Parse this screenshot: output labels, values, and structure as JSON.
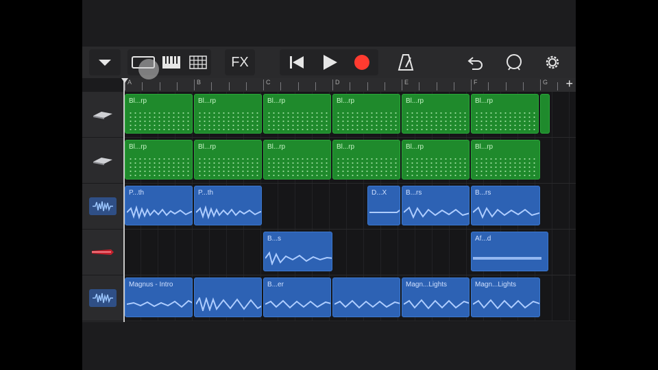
{
  "toolbar": {
    "menu_icon": "chevron-down-icon",
    "view_icons": [
      "tracks-view-icon",
      "keyboard-icon",
      "grid-icon"
    ],
    "fx_label": "FX",
    "transport_icons": [
      "rewind-icon",
      "play-icon",
      "record-icon"
    ],
    "metronome_icon": "metronome-icon",
    "right_icons": [
      "undo-icon",
      "loop-icon",
      "settings-icon"
    ],
    "record_color": "#ff3b30"
  },
  "ruler": {
    "bars": [
      "A",
      "B",
      "C",
      "D",
      "E",
      "F",
      "G"
    ],
    "add_label": "+"
  },
  "tracks": [
    {
      "icon": "synth-icon",
      "type": "midi",
      "regions": [
        "Bl...rp",
        "Bl...rp",
        "Bl...rp",
        "Bl...rp",
        "Bl...rp",
        "Bl...rp",
        ""
      ]
    },
    {
      "icon": "synth-icon",
      "type": "midi",
      "regions": [
        "Bl...rp",
        "Bl...rp",
        "Bl...rp",
        "Bl...rp",
        "Bl...rp",
        "Bl...rp"
      ]
    },
    {
      "icon": "audio-waveform-icon",
      "type": "audio",
      "regions": [
        "P...th",
        "P...th",
        "D...X",
        "B...rs",
        "B...rs"
      ]
    },
    {
      "icon": "guitar-icon",
      "type": "audio",
      "regions": [
        "B...s",
        "Af...d"
      ]
    },
    {
      "icon": "audio-waveform-icon",
      "type": "audio",
      "regions": [
        "Magnus - Intro",
        "",
        "B...er",
        "",
        "Magn...Lights",
        "Magn...Lights"
      ]
    }
  ],
  "colors": {
    "midi_region": "#1f8a2c",
    "audio_region": "#2d62b4"
  }
}
